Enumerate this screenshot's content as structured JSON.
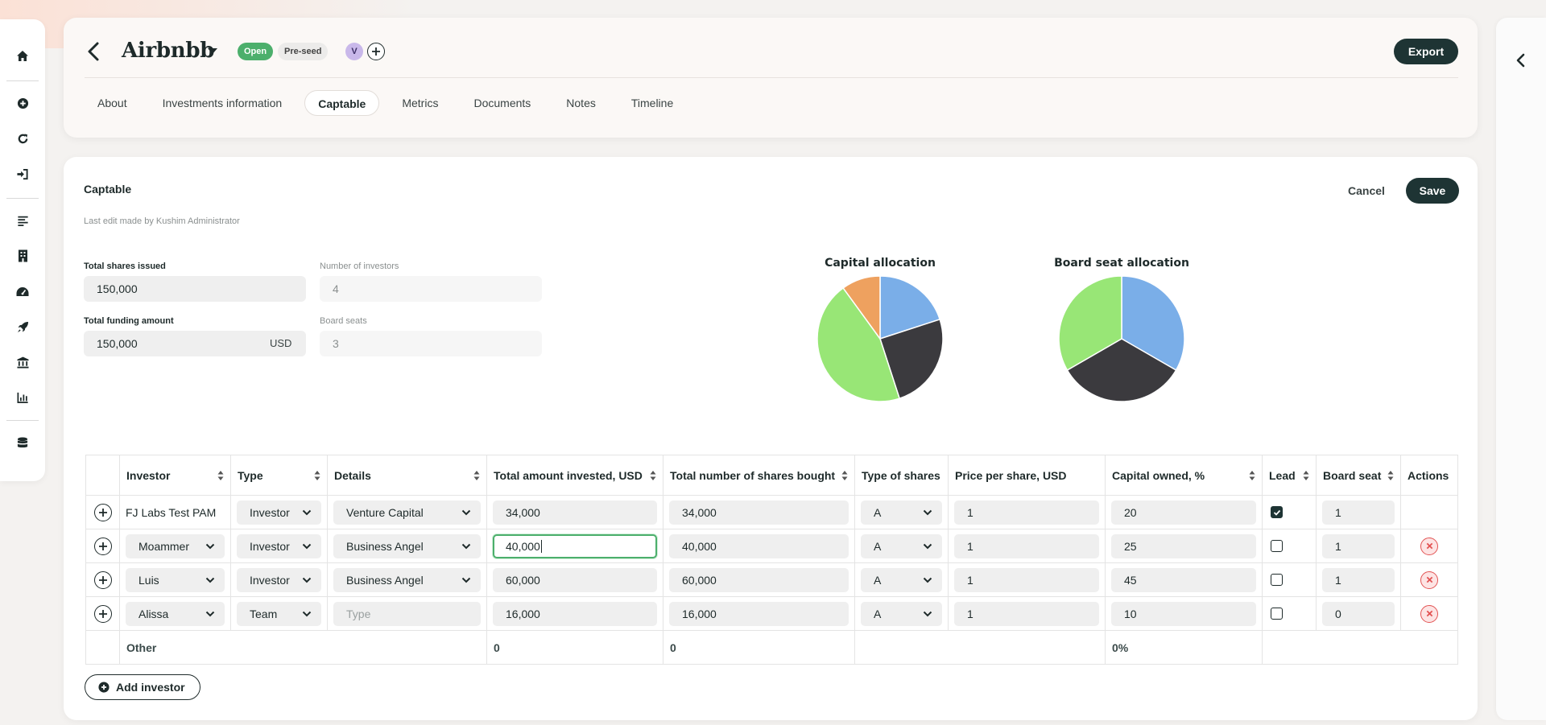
{
  "sidebar": {
    "icons": [
      "home-icon",
      "plus-circle-icon",
      "refresh-icon",
      "sign-in-icon",
      "list-icon",
      "building-icon",
      "dashboard-icon",
      "rocket-icon",
      "bank-icon",
      "chart-icon",
      "database-icon"
    ]
  },
  "header": {
    "title": "Airbnbb",
    "status_badge": "Open",
    "stage_badge": "Pre-seed",
    "avatar_initial": "V",
    "export_label": "Export",
    "tabs": [
      {
        "label": "About",
        "active": false
      },
      {
        "label": "Investments information",
        "active": false
      },
      {
        "label": "Captable",
        "active": true
      },
      {
        "label": "Metrics",
        "active": false
      },
      {
        "label": "Documents",
        "active": false
      },
      {
        "label": "Notes",
        "active": false
      },
      {
        "label": "Timeline",
        "active": false
      }
    ]
  },
  "captable": {
    "title": "Captable",
    "last_edit": "Last edit made by Kushim Administrator",
    "cancel_label": "Cancel",
    "save_label": "Save",
    "total_shares_label": "Total shares issued",
    "total_shares_value": "150,000",
    "num_investors_label": "Number of investors",
    "num_investors_value": "4",
    "total_funding_label": "Total funding amount",
    "total_funding_value": "150,000",
    "total_funding_currency": "USD",
    "board_seats_label": "Board seats",
    "board_seats_value": "3",
    "add_investor_label": "Add investor"
  },
  "chart_data": [
    {
      "type": "pie",
      "title": "Capital allocation",
      "values": [
        20,
        25,
        45,
        10
      ],
      "colors": [
        "#7aaee8",
        "#3b3a3e",
        "#98e676",
        "#eea15f"
      ]
    },
    {
      "type": "pie",
      "title": "Board seat allocation",
      "values": [
        1,
        1,
        1
      ],
      "colors": [
        "#7aaee8",
        "#3b3a3e",
        "#98e676"
      ]
    }
  ],
  "table": {
    "headers": {
      "investor": "Investor",
      "type": "Type",
      "details": "Details",
      "amount": "Total amount invested, USD",
      "shares": "Total number of shares bought",
      "share_type": "Type of shares",
      "price": "Price per share, USD",
      "capital": "Capital owned, %",
      "lead": "Lead",
      "board_seat": "Board seat",
      "actions": "Actions"
    },
    "rows": [
      {
        "investor": "FJ Labs Test PAM",
        "type": "Investor",
        "details": "Venture Capital",
        "amount": "34,000",
        "shares": "34,000",
        "share_type": "A",
        "price": "1",
        "capital": "20",
        "lead": true,
        "board_seat": "1"
      },
      {
        "investor": "Moammer",
        "type": "Investor",
        "details": "Business Angel",
        "amount": "40,000",
        "shares": "40,000",
        "share_type": "A",
        "price": "1",
        "capital": "25",
        "lead": false,
        "board_seat": "1"
      },
      {
        "investor": "Luis",
        "type": "Investor",
        "details": "Business Angel",
        "amount": "60,000",
        "shares": "60,000",
        "share_type": "A",
        "price": "1",
        "capital": "45",
        "lead": false,
        "board_seat": "1"
      },
      {
        "investor": "Alissa",
        "type": "Team",
        "details": "",
        "details_placeholder": "Type",
        "amount": "16,000",
        "shares": "16,000",
        "share_type": "A",
        "price": "1",
        "capital": "10",
        "lead": false,
        "board_seat": "0"
      }
    ],
    "other": {
      "label": "Other",
      "amount": "0",
      "shares": "0",
      "capital": "0%"
    }
  }
}
